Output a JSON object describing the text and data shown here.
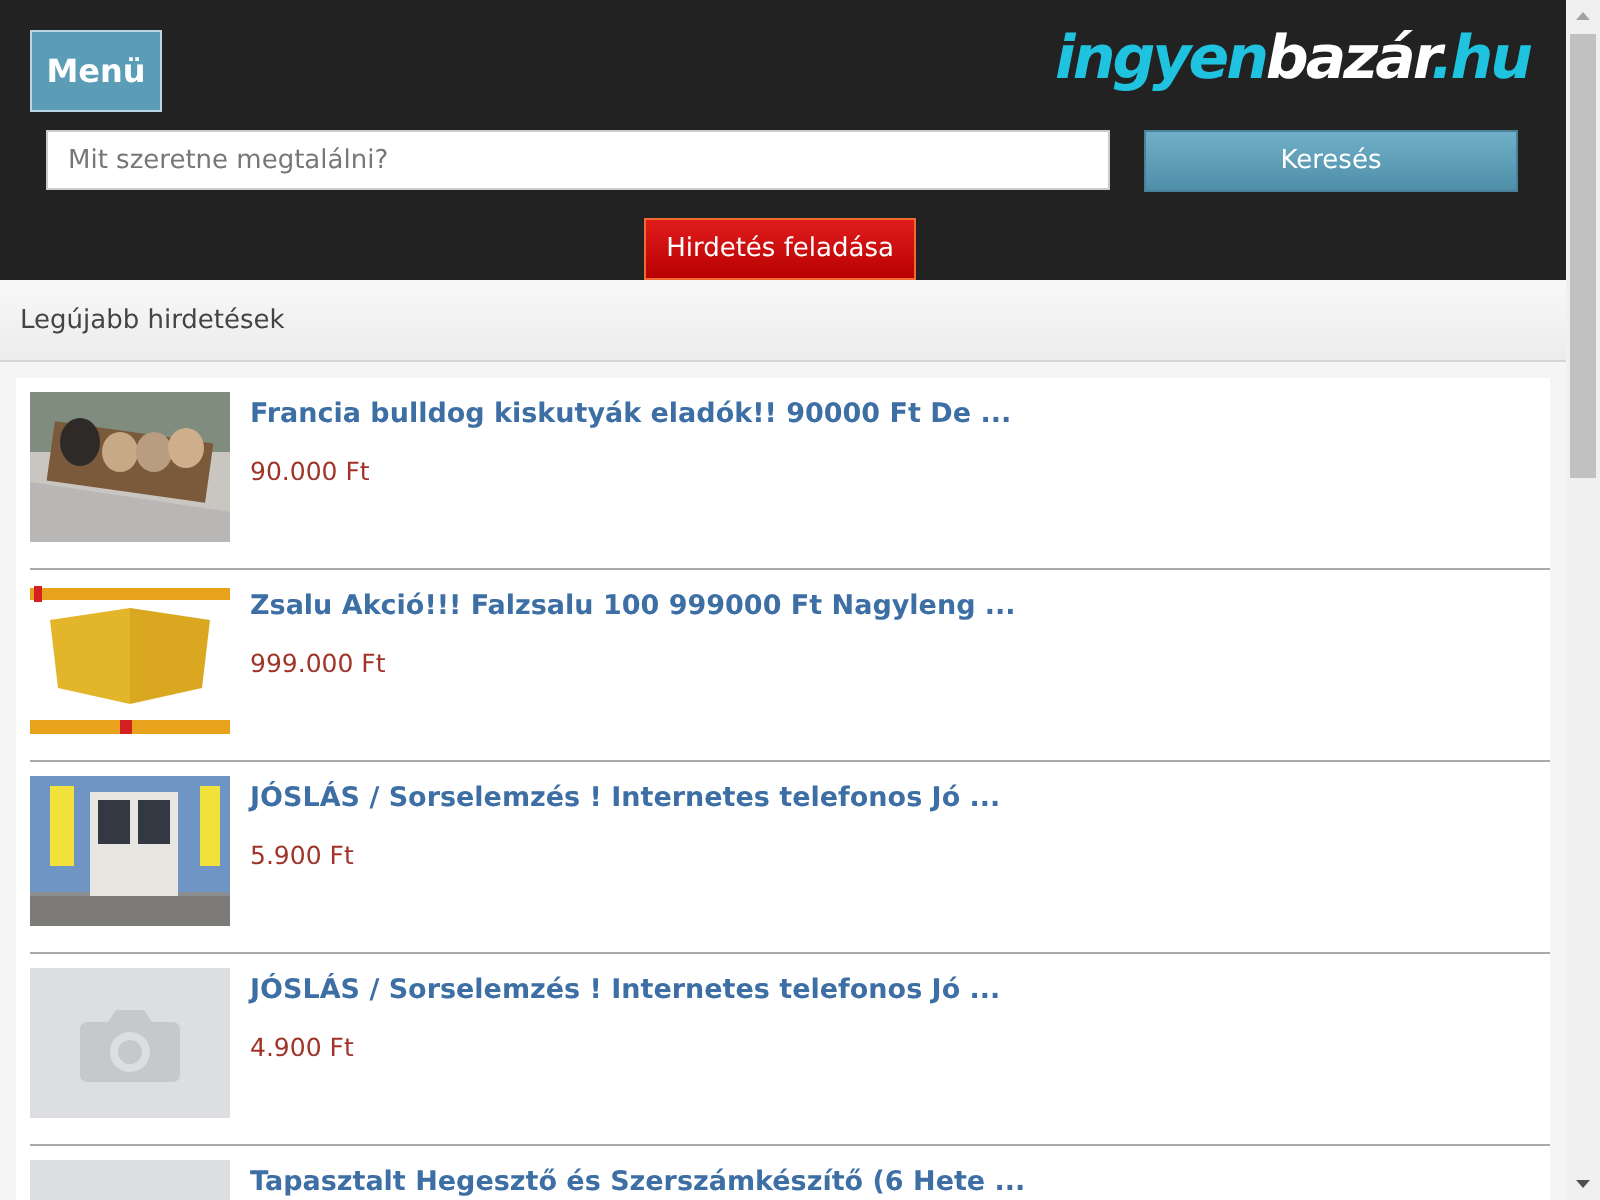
{
  "header": {
    "menu_button": "Menü",
    "logo": {
      "parts": [
        {
          "text": "ingyen",
          "kind": "accent"
        },
        {
          "text": "bazár",
          "kind": "plain"
        },
        {
          "text": ".hu",
          "kind": "accent"
        }
      ]
    },
    "search": {
      "placeholder": "Mit szeretne megtalálni?",
      "button": "Keresés"
    },
    "post_button": "Hirdetés feladása"
  },
  "section_title": "Legújabb hirdetések",
  "listings": [
    {
      "title": "Francia bulldog kiskutyák eladók!! 90000 Ft De ...",
      "price": "90.000 Ft",
      "image": {
        "kind": "dogs"
      }
    },
    {
      "title": "Zsalu Akció!!! Falzsalu 100 999000 Ft Nagyleng ...",
      "price": "999.000 Ft",
      "image": {
        "kind": "panels"
      }
    },
    {
      "title": "JÓSLÁS / Sorselemzés ! Internetes telefonos Jó ...",
      "price": "5.900 Ft",
      "image": {
        "kind": "shopfront"
      }
    },
    {
      "title": "JÓSLÁS / Sorselemzés ! Internetes telefonos Jó ...",
      "price": "4.900 Ft",
      "image": {
        "kind": "placeholder"
      }
    },
    {
      "title": "Tapasztalt Hegesztő és Szerszámkészítő (6 Hete ...",
      "image": {
        "kind": "blank"
      }
    }
  ]
}
